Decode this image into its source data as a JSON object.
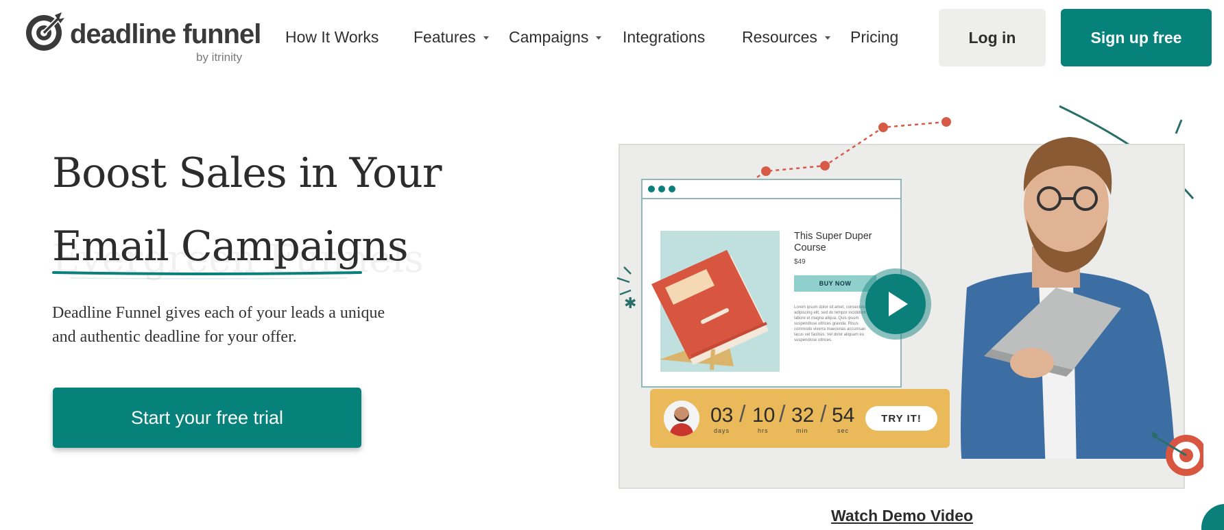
{
  "brand": {
    "name": "deadline funnel",
    "byline": "by itrinity",
    "accent": "#06827b"
  },
  "nav": {
    "items": [
      {
        "label": "How It Works",
        "has_dropdown": false
      },
      {
        "label": "Features",
        "has_dropdown": true
      },
      {
        "label": "Campaigns",
        "has_dropdown": true
      },
      {
        "label": "Integrations",
        "has_dropdown": false
      },
      {
        "label": "Resources",
        "has_dropdown": true
      },
      {
        "label": "Pricing",
        "has_dropdown": false
      }
    ],
    "login_label": "Log in",
    "signup_label": "Sign up free"
  },
  "hero": {
    "title_line1": "Boost Sales in Your",
    "title_line2": "Email Campaigns",
    "ghost_text": "Evergreen Funnels",
    "description": "Deadline Funnel gives each of your leads a unique and authentic deadline for your offer.",
    "cta_label": "Start your free trial"
  },
  "demo": {
    "course_title": "This Super Duper Course",
    "course_price": "$49",
    "buy_now_label": "BUY NOW",
    "lorem": "Lorem ipsum dolor sit amet, consectetur adipiscing elit, sed do tempor incididunt ut labore et magna aliqua. Quis ipsum suspendisse ultrices gravida. Risus commodo viverra maecenas accumsan lacus vel facilisis. Vel dolor aliquam eu suspendisse ultrices.",
    "countdown": [
      {
        "value": "03",
        "unit": "days"
      },
      {
        "value": "10",
        "unit": "hrs"
      },
      {
        "value": "32",
        "unit": "min"
      },
      {
        "value": "54",
        "unit": "sec"
      }
    ],
    "try_label": "TRY IT!",
    "watch_label": "Watch Demo Video"
  }
}
